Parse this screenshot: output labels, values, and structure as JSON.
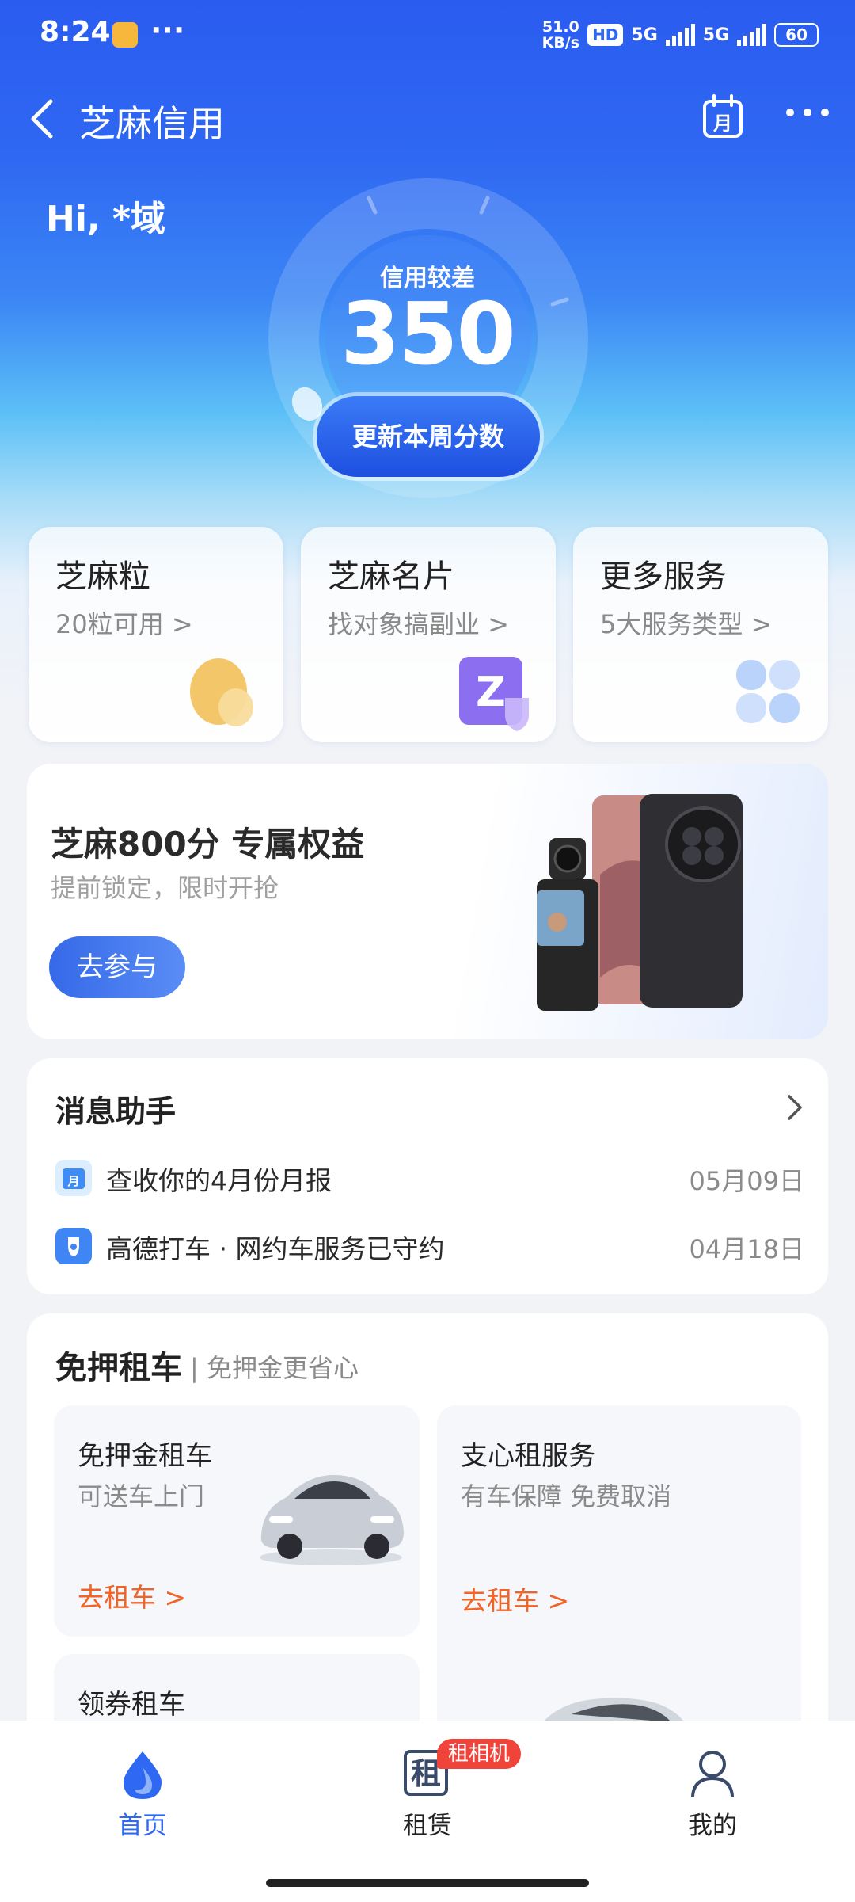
{
  "status_bar": {
    "time": "8:24",
    "net_speed_value": "51.0",
    "net_speed_unit": "KB/s",
    "hd": "HD",
    "sig1": "5G",
    "sig2": "5G",
    "battery": "60"
  },
  "nav": {
    "title": "芝麻信用"
  },
  "hero": {
    "greeting": "Hi, *域",
    "credit_level": "信用较差",
    "score": "350",
    "update_button": "更新本周分数"
  },
  "services": [
    {
      "title": "芝麻粒",
      "subtitle": "20粒可用 >"
    },
    {
      "title": "芝麻名片",
      "subtitle": "找对象搞副业 >"
    },
    {
      "title": "更多服务",
      "subtitle": "5大服务类型 >"
    }
  ],
  "promo": {
    "title": "芝麻800分 专属权益",
    "subtitle": "提前锁定，限时开抢",
    "button": "去参与"
  },
  "messages": {
    "title": "消息助手",
    "items": [
      {
        "text": "查收你的4月份月报",
        "date": "05月09日",
        "icon": "calendar-icon"
      },
      {
        "text": "高德打车 · 网约车服务已守约",
        "date": "04月18日",
        "icon": "car-service-icon"
      }
    ]
  },
  "rental": {
    "title": "免押租车",
    "subtitle": "| 免押金更省心",
    "tiles": [
      {
        "title": "免押金租车",
        "subtitle": "可送车上门",
        "link": "去租车 >"
      },
      {
        "title": "支心租服务",
        "subtitle": "有车保障 免费取消",
        "link": "去租车 >"
      },
      {
        "title": "领券租车"
      }
    ]
  },
  "tabbar": {
    "tabs": [
      {
        "label": "首页"
      },
      {
        "label": "租赁"
      },
      {
        "label": "我的"
      }
    ],
    "badge": "租相机",
    "rent_icon_char": "租"
  },
  "colors": {
    "primary": "#2f68f2",
    "active_tab": "#2f68f2",
    "link_orange": "#f06428",
    "badge_red": "#f0443a"
  }
}
